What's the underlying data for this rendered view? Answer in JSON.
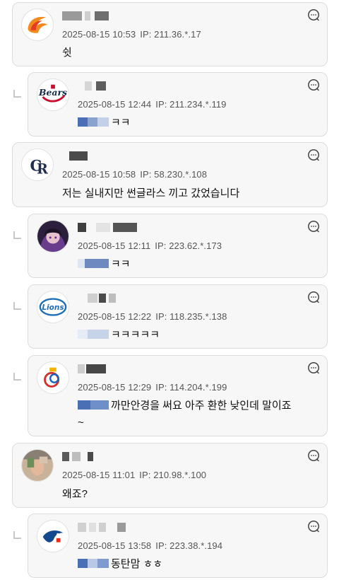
{
  "comments": [
    {
      "level": "top",
      "date": "2025-08-15 10:53",
      "ip": "IP: 211.36.*.17",
      "text": "쉿",
      "avatar": "flame-emblem"
    },
    {
      "level": "reply",
      "date": "2025-08-15 12:44",
      "ip": "IP: 211.234.*.119",
      "text": "ㅋㅋ",
      "avatar": "bears-logo"
    },
    {
      "level": "top",
      "date": "2025-08-15 10:58",
      "ip": "IP: 58.230.*.108",
      "text": "저는 실내지만 썬글라스 끼고 갔었습니다",
      "avatar": "ck-monogram"
    },
    {
      "level": "reply",
      "date": "2025-08-15 12:11",
      "ip": "IP: 223.62.*.173",
      "text": "ㅋㅋ",
      "avatar": "anime-character"
    },
    {
      "level": "reply",
      "date": "2025-08-15 12:22",
      "ip": "IP: 118.235.*.138",
      "text": "ㅋㅋㅋㅋㅋ",
      "avatar": "lions-logo"
    },
    {
      "level": "reply",
      "date": "2025-08-15 12:29",
      "ip": "IP: 114.204.*.199",
      "text": "까만안경을 써요 아주 환한 낮인데 말이죠",
      "text2": "~",
      "avatar": "olympic-emblem"
    },
    {
      "level": "top",
      "date": "2025-08-15 11:01",
      "ip": "IP: 210.98.*.100",
      "text": "왜죠?",
      "avatar": "person-photo"
    },
    {
      "level": "reply",
      "date": "2025-08-15 13:58",
      "ip": "IP: 223.38.*.194",
      "text": "동탄맘 ㅎㅎ",
      "avatar": "bluejays-logo"
    }
  ],
  "colors": {
    "card_bg": "#f7f7f7",
    "card_border": "#dcdcdc",
    "meta_text": "#555555",
    "body_text": "#111111",
    "mention_blue": "#4a6fb5"
  }
}
